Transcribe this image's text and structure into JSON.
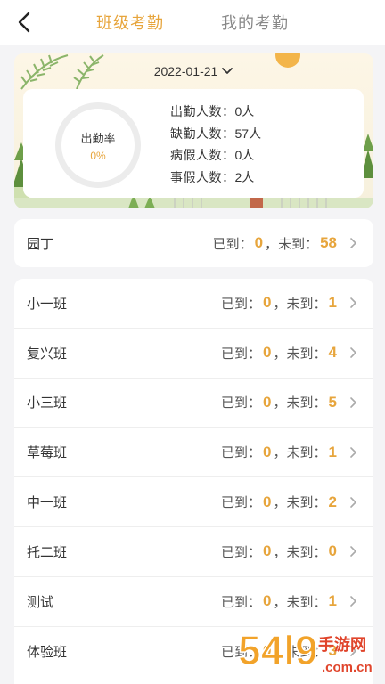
{
  "tabs": [
    {
      "label": "班级考勤",
      "active": true
    },
    {
      "label": "我的考勤",
      "active": false
    }
  ],
  "summary": {
    "date": "2022-01-21",
    "rate_label": "出勤率",
    "rate_value": "0%",
    "stats": [
      {
        "label": "出勤人数：",
        "value": "0人"
      },
      {
        "label": "缺勤人数：",
        "value": "57人"
      },
      {
        "label": "病假人数：",
        "value": "0人"
      },
      {
        "label": "事假人数：",
        "value": "2人"
      }
    ]
  },
  "gardener": {
    "name": "园丁",
    "arrived_label": "已到：",
    "arrived": "0",
    "sep": "，",
    "missing_label": "未到：",
    "missing": "58"
  },
  "classes": [
    {
      "name": "小一班",
      "arrived_label": "已到：",
      "arrived": "0",
      "sep": "，",
      "missing_label": "未到：",
      "missing": "1"
    },
    {
      "name": "复兴班",
      "arrived_label": "已到：",
      "arrived": "0",
      "sep": "，",
      "missing_label": "未到：",
      "missing": "4"
    },
    {
      "name": "小三班",
      "arrived_label": "已到：",
      "arrived": "0",
      "sep": "，",
      "missing_label": "未到：",
      "missing": "5"
    },
    {
      "name": "草莓班",
      "arrived_label": "已到：",
      "arrived": "0",
      "sep": "，",
      "missing_label": "未到：",
      "missing": "1"
    },
    {
      "name": "中一班",
      "arrived_label": "已到：",
      "arrived": "0",
      "sep": "，",
      "missing_label": "未到：",
      "missing": "2"
    },
    {
      "name": "托二班",
      "arrived_label": "已到：",
      "arrived": "0",
      "sep": "，",
      "missing_label": "未到：",
      "missing": "0"
    },
    {
      "name": "测试",
      "arrived_label": "已到：",
      "arrived": "0",
      "sep": "，",
      "missing_label": "未到：",
      "missing": "1"
    },
    {
      "name": "体验班",
      "arrived_label": "已到：",
      "arrived": "0",
      "sep": "，",
      "missing_label": "未到：",
      "missing": "3"
    }
  ],
  "watermark": {
    "brand": "54l9",
    "text": "手游网",
    "domain": ".com.cn"
  },
  "colors": {
    "accent": "#e7a53c",
    "background": "#f4f4f6",
    "card": "#ffffff"
  }
}
